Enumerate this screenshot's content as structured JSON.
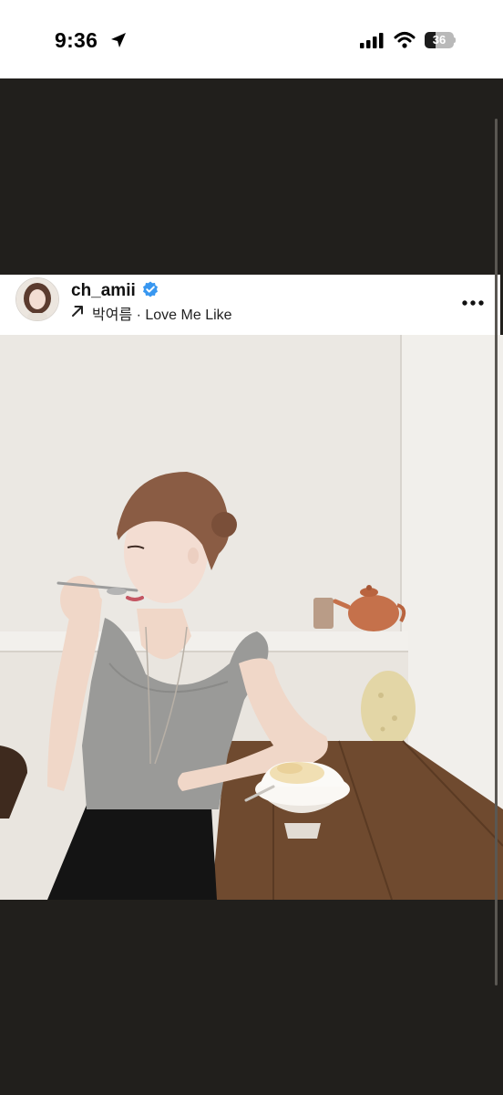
{
  "status_bar": {
    "time": "9:36",
    "battery_level": "36",
    "battery_fraction": 0.36,
    "icons": [
      "location-arrow-icon",
      "cellular-signal-icon",
      "wifi-icon",
      "battery-icon"
    ]
  },
  "post": {
    "username": "ch_amii",
    "verified": true,
    "music_label": "박여름 · Love Me Like",
    "icons": [
      "avatar",
      "verified-badge-icon",
      "music-arrow-icon",
      "more-options-icon"
    ]
  },
  "colors": {
    "background_dark": "#211f1c",
    "verified_blue": "#3897f0"
  }
}
